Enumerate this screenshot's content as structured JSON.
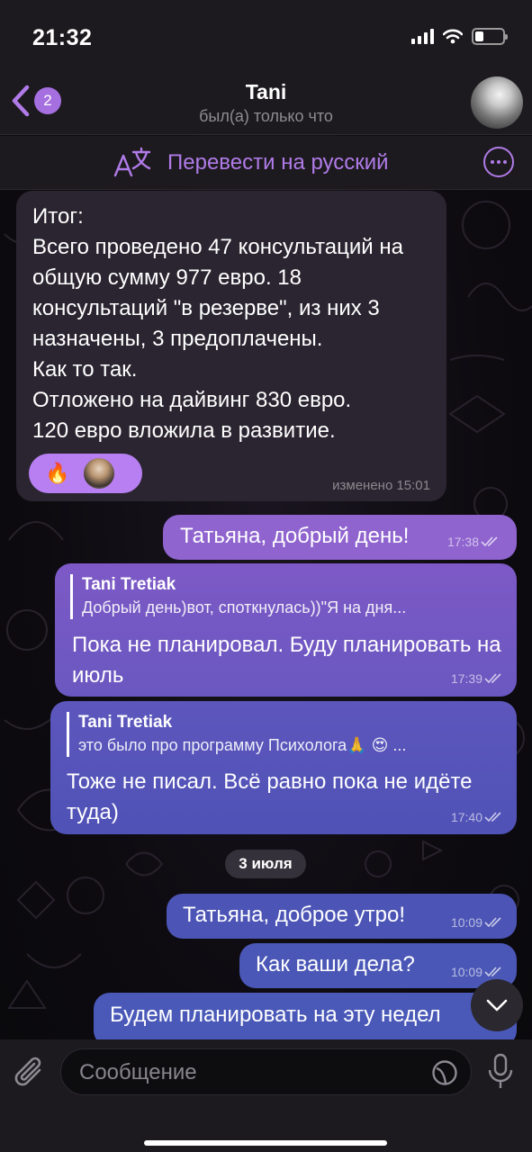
{
  "status_bar": {
    "time": "21:32"
  },
  "header": {
    "back_badge": "2",
    "title": "Tani",
    "subtitle": "был(а) только что"
  },
  "translate_bar": {
    "label": "Перевести на русский"
  },
  "messages": [
    {
      "direction": "in",
      "text": "Итог:\nВсего проведено 47 консультаций на общую сумму 977 евро. 18 консультаций \"в резерве\", из них 3 назначены, 3 предоплачены.\nКак то так.\nОтложено на дайвинг 830 евро.\n120 евро вложила в развитие.",
      "reaction_emoji": "🔥",
      "time": "изменено 15:01"
    },
    {
      "direction": "out",
      "text": "Татьяна, добрый день!",
      "time": "17:38"
    },
    {
      "direction": "out",
      "reply_name": "Tani Tretiak",
      "reply_text": "Добрый день)вот, споткнулась))\"Я на дня...",
      "text": "Пока не планировал. Буду планировать на июль",
      "time": "17:39"
    },
    {
      "direction": "out",
      "reply_name": "Tani Tretiak",
      "reply_text": "это было про программу Психолога🙏 😍 ...",
      "text": "Тоже не писал. Всё равно пока не идёте туда)",
      "time": "17:40"
    },
    {
      "direction": "out",
      "text": "Татьяна, доброе утро!",
      "time": "10:09"
    },
    {
      "direction": "out",
      "text": "Как ваши дела?",
      "time": "10:09"
    },
    {
      "direction": "out",
      "text": "Будем планировать на эту недел",
      "time": ""
    }
  ],
  "date_separator": "3 июля",
  "input": {
    "placeholder": "Сообщение"
  },
  "colors": {
    "accent": "#b07be8",
    "incoming_bubble": "#2a2530",
    "outgoing_top": "#8f64cf",
    "outgoing_bottom": "#4a59b8",
    "bar_background": "#1c1a1e"
  },
  "icons": [
    "back-chevron-icon",
    "translate-icon",
    "more-icon",
    "double-check-icon",
    "chevron-down-icon",
    "paperclip-icon",
    "sticker-icon",
    "microphone-icon"
  ]
}
